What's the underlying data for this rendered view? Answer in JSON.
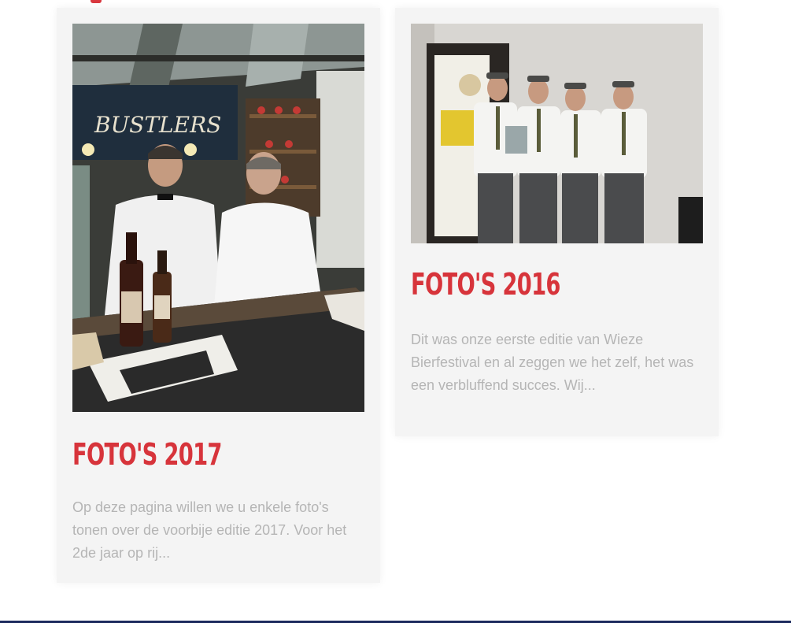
{
  "colors": {
    "accent": "#d7343b",
    "card_bg": "#f4f4f4",
    "text_muted": "#b5b5b5",
    "footer_rule": "#1c2a5e"
  },
  "cards": [
    {
      "title": "FOTO'S 2017",
      "excerpt": "Op deze pagina willen we u enkele foto's tonen over de voorbije editie 2017. Voor het 2de jaar op rij...",
      "image_sign": "BUSTLERS"
    },
    {
      "title": "FOTO'S 2016",
      "excerpt": "Dit was onze eerste editie van Wieze Bierfestival en al zeggen we het zelf, het was een verbluffend succes. Wij..."
    }
  ]
}
